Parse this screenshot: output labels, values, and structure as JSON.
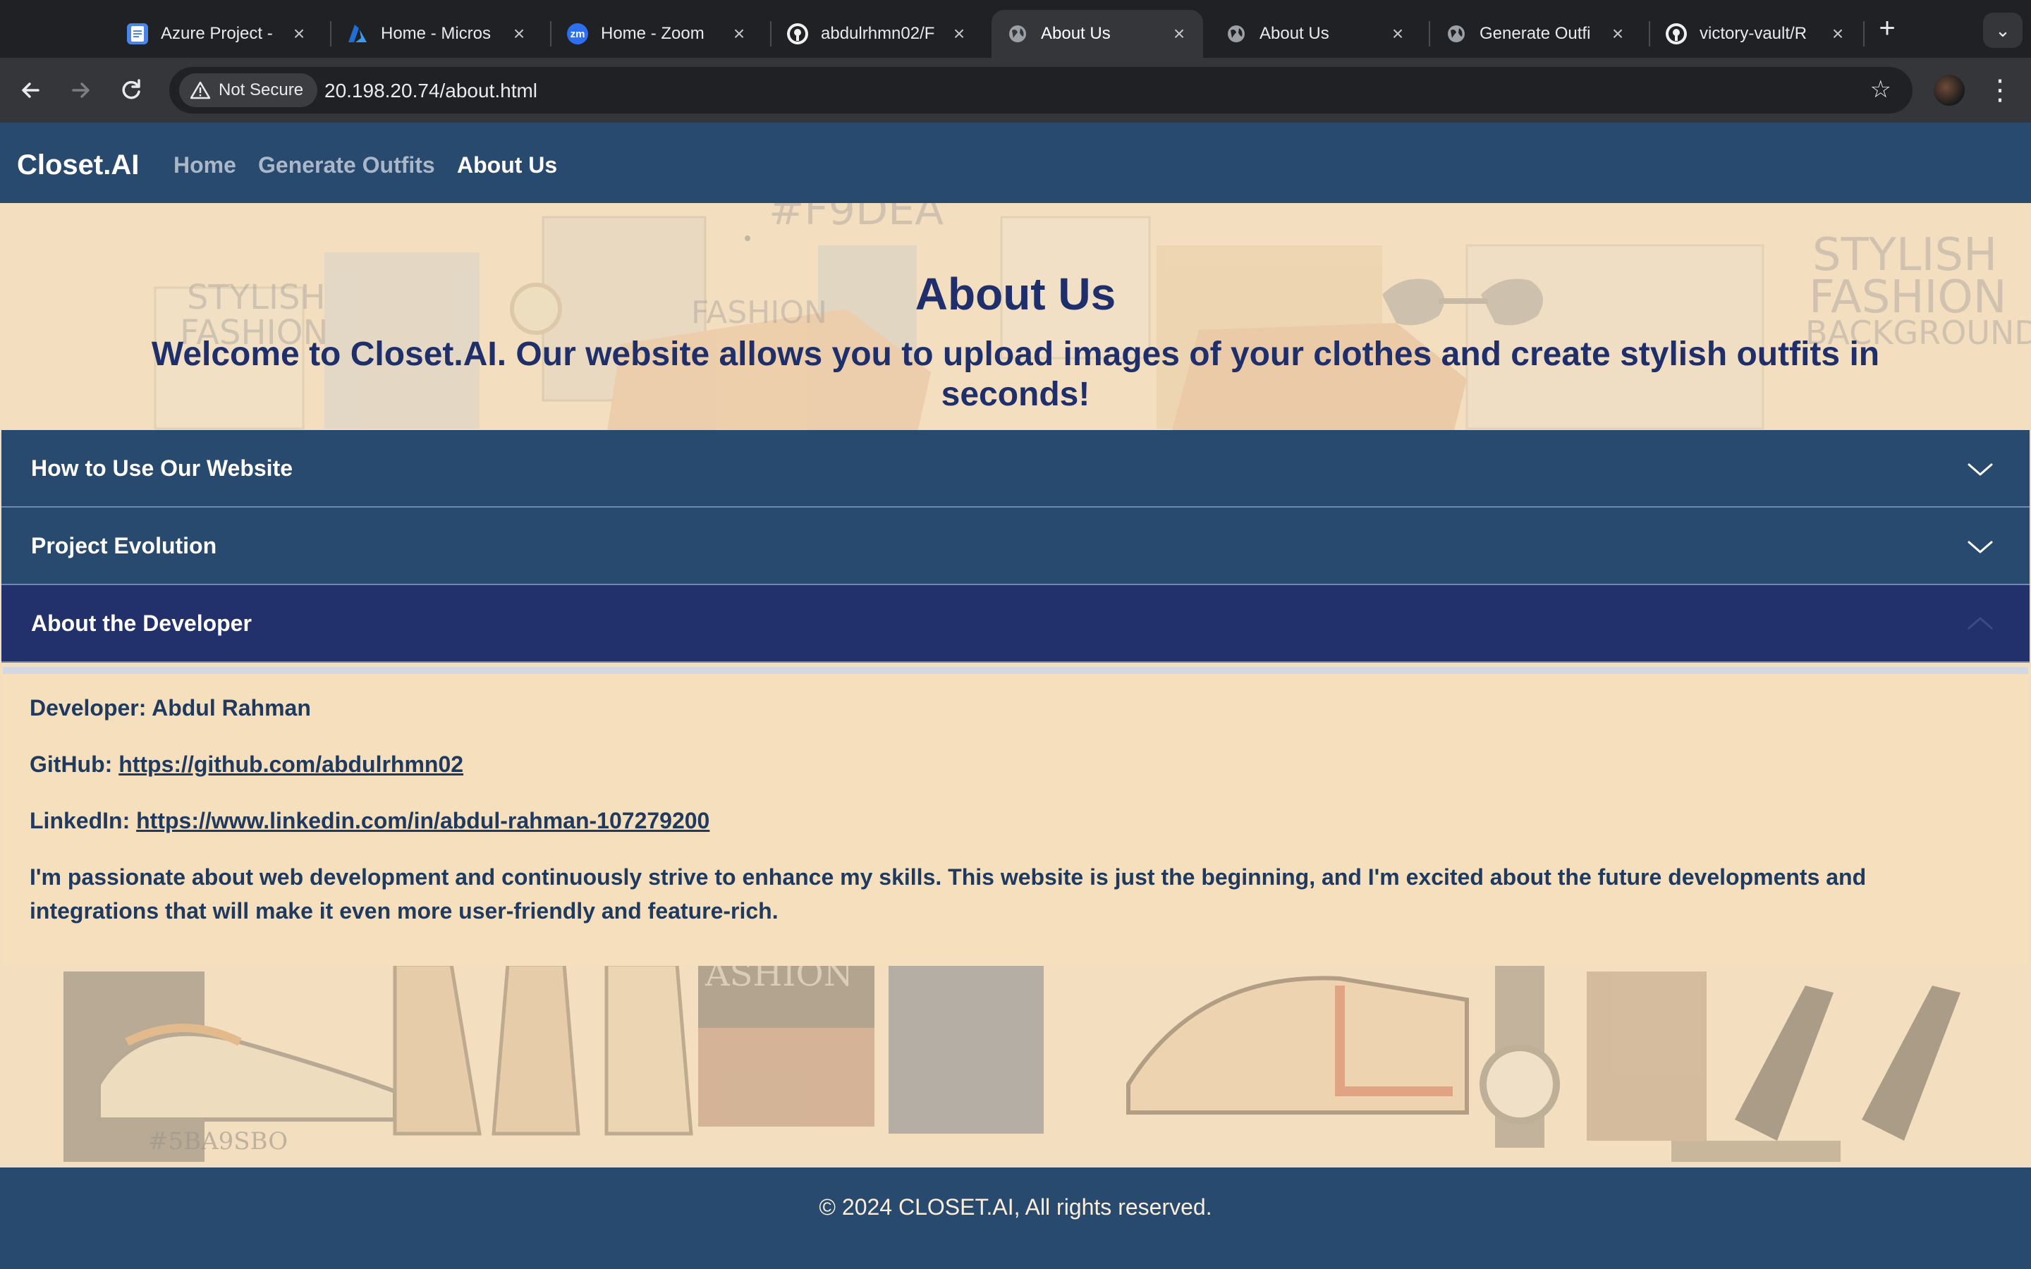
{
  "browser": {
    "tabs": [
      {
        "title": "Azure Project -",
        "icon": "docs-icon"
      },
      {
        "title": "Home - Micros",
        "icon": "azure-icon"
      },
      {
        "title": "Home - Zoom",
        "icon": "zoom-icon",
        "icon_text": "zm"
      },
      {
        "title": "abdulrhmn02/F",
        "icon": "github-icon"
      },
      {
        "title": "About Us",
        "icon": "globe-icon",
        "active": true
      },
      {
        "title": "About Us",
        "icon": "globe-icon"
      },
      {
        "title": "Generate Outfi",
        "icon": "globe-icon"
      },
      {
        "title": "victory-vault/R",
        "icon": "github-icon"
      }
    ],
    "security_label": "Not Secure",
    "url": "20.198.20.74/about.html"
  },
  "site": {
    "brand": "Closet.AI",
    "nav": {
      "home": "Home",
      "generate": "Generate Outfits",
      "about": "About Us"
    },
    "active_nav": "About Us"
  },
  "hero": {
    "title": "About Us",
    "subtitle": "Welcome to Closet.AI. Our website allows you to upload images of your clothes and create stylish outfits in seconds!"
  },
  "accordion": {
    "items": [
      {
        "label": "How to Use Our Website",
        "expanded": false
      },
      {
        "label": "Project Evolution",
        "expanded": false
      },
      {
        "label": "About the Developer",
        "expanded": true
      }
    ],
    "developer": {
      "developer_line": "Developer: Abdul Rahman",
      "github_label": "GitHub:",
      "github_url": "https://github.com/abdulrhmn02",
      "linkedin_label": "LinkedIn:",
      "linkedin_url": "https://www.linkedin.com/in/abdul-rahman-107279200",
      "paragraph": "I'm passionate about web development and continuously strive to enhance my skills. This website is just the beginning, and I'm excited about the future developments and integrations that will make it even more user-friendly and feature-rich."
    }
  },
  "footer": {
    "text": "© 2024 CLOSET.AI, All rights reserved."
  },
  "background_text": {
    "hex_top": "#F9DEA",
    "stylish_left": "STYLISH",
    "fashion_left": "FASHION",
    "fashion_mid": "FASHION",
    "stylish_right": "STYLISH",
    "fashion_right": "FASHION",
    "background_right": "BACKGROUND",
    "fashion_bottom": "ASHION",
    "hex_bottom": "#5BA9SBO"
  },
  "colors": {
    "nav_bg": "#284a6e",
    "accordion_open_bg": "#22306c",
    "heading_text": "#1f2f6b",
    "page_bg": "#f3dfbf",
    "panel_bg": "#f5dfbc"
  }
}
